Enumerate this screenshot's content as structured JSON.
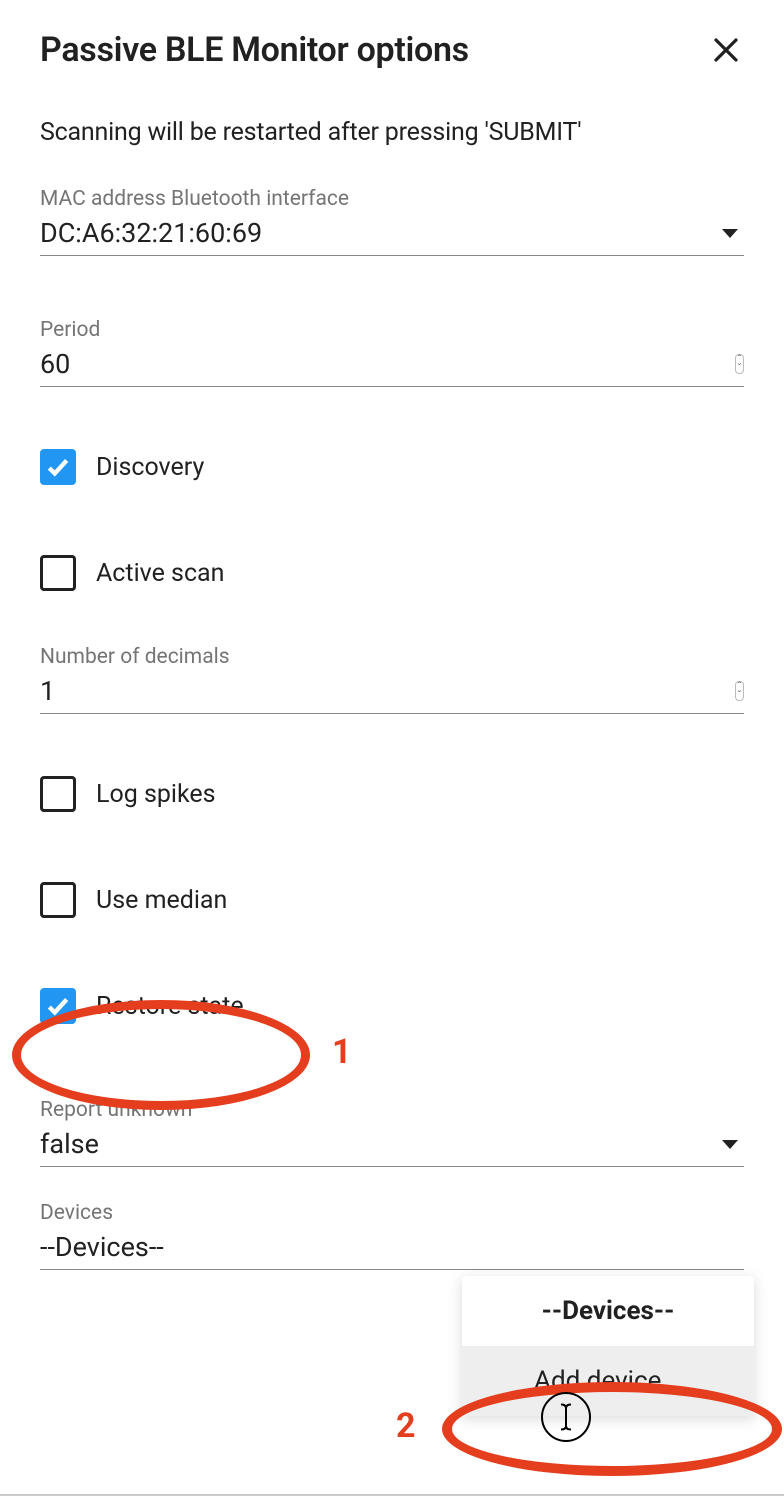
{
  "title": "Passive BLE Monitor options",
  "intro": "Scanning will be restarted after pressing 'SUBMIT'",
  "fields": {
    "mac": {
      "label": "MAC address Bluetooth interface",
      "value": "DC:A6:32:21:60:69"
    },
    "period": {
      "label": "Period",
      "value": "60"
    },
    "decimals": {
      "label": "Number of decimals",
      "value": "1"
    },
    "report_unknown": {
      "label": "Report unknown",
      "value": "false"
    },
    "devices": {
      "label": "Devices",
      "value": "--Devices--"
    }
  },
  "checkboxes": {
    "discovery": {
      "label": "Discovery",
      "checked": true
    },
    "active_scan": {
      "label": "Active scan",
      "checked": false
    },
    "log_spikes": {
      "label": "Log spikes",
      "checked": false
    },
    "use_median": {
      "label": "Use median",
      "checked": false
    },
    "restore_state": {
      "label": "Restore state",
      "checked": true
    }
  },
  "dropdown": {
    "item1": "--Devices--",
    "item2": "Add device..."
  },
  "annotations": {
    "a1": "1",
    "a2": "2"
  }
}
